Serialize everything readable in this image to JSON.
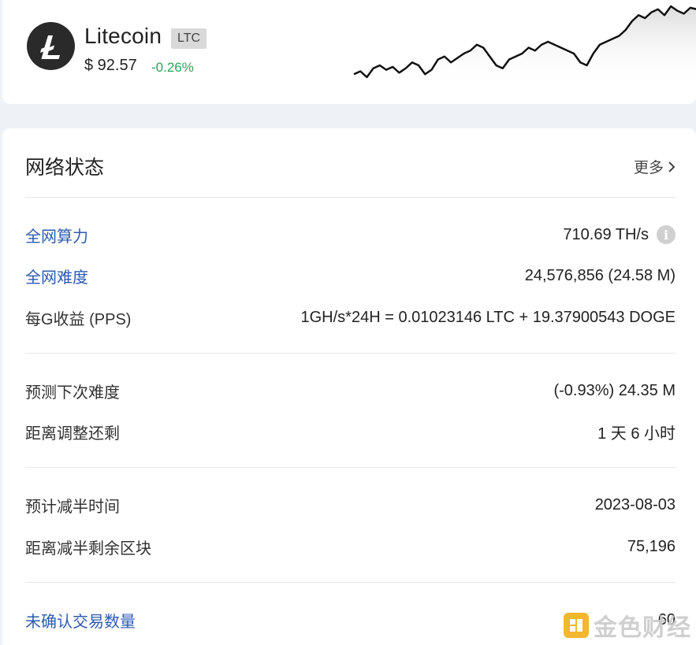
{
  "coin": {
    "name": "Litecoin",
    "symbol": "LTC",
    "price": "$ 92.57",
    "change": "-0.26%",
    "change_color": "#2aa55a",
    "logo_icon": "litecoin-logo-icon"
  },
  "sparkline": {
    "type": "line",
    "values": [
      52,
      54,
      50,
      56,
      58,
      55,
      57,
      53,
      56,
      60,
      58,
      52,
      55,
      62,
      64,
      60,
      63,
      66,
      68,
      72,
      70,
      64,
      58,
      56,
      62,
      64,
      66,
      70,
      68,
      72,
      74,
      72,
      70,
      68,
      66,
      60,
      58,
      66,
      72,
      74,
      76,
      78,
      82,
      88,
      92,
      90,
      94,
      96,
      92,
      98,
      95,
      93,
      97,
      96
    ]
  },
  "network": {
    "title": "网络状态",
    "more_label": "更多",
    "rows": [
      {
        "label": "全网算力",
        "value": "710.69 TH/s"
      },
      {
        "label": "全网难度",
        "value": "24,576,856 (24.58 M)"
      },
      {
        "label": "每G收益 (PPS)",
        "value": "1GH/s*24H = 0.01023146 LTC + 19.37900543 DOGE"
      },
      {
        "label": "预测下次难度",
        "value": "(-0.93%) 24.35 M"
      },
      {
        "label": "距离调整还剩",
        "value": "1 天 6 小时"
      },
      {
        "label": "预计减半时间",
        "value": "2023-08-03"
      },
      {
        "label": "距离减半剩余区块",
        "value": "75,196"
      },
      {
        "label": "未确认交易数量",
        "value": "60"
      }
    ]
  },
  "watermark": {
    "text": "金色财经"
  }
}
